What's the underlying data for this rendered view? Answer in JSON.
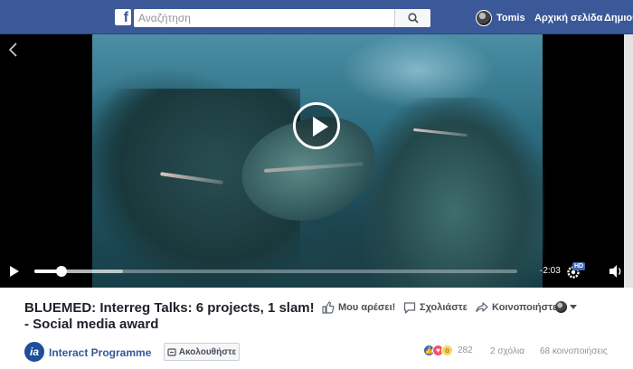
{
  "header": {
    "logo_letter": "f",
    "search": {
      "placeholder": "Αναζήτηση",
      "value": ""
    },
    "user_name": "Tomis",
    "home_label": "Αρχική σελίδα",
    "create_label": "Δημιου"
  },
  "video": {
    "time_remaining": "-2:03",
    "quality_badge": "HD",
    "progress": 0.057,
    "buffered": 0.184
  },
  "post": {
    "title": "BLUEMED: Interreg Talks: 6 projects, 1 slam! - Social media award",
    "actions": {
      "like": "Μου αρέσει!",
      "comment": "Σχολιάστε",
      "share": "Κοινοποιήστε"
    },
    "page": {
      "logo_text": "ia",
      "name": "Interact Programme",
      "follow_label": "Ακολουθήστε"
    },
    "stats": {
      "reactions": "282",
      "comments": "2 σχόλια",
      "shares": "68 κοινοποιήσεις"
    }
  },
  "colors": {
    "brand": "#3b5998",
    "link": "#365899",
    "text": "#1d2129",
    "muted": "#90949c"
  }
}
